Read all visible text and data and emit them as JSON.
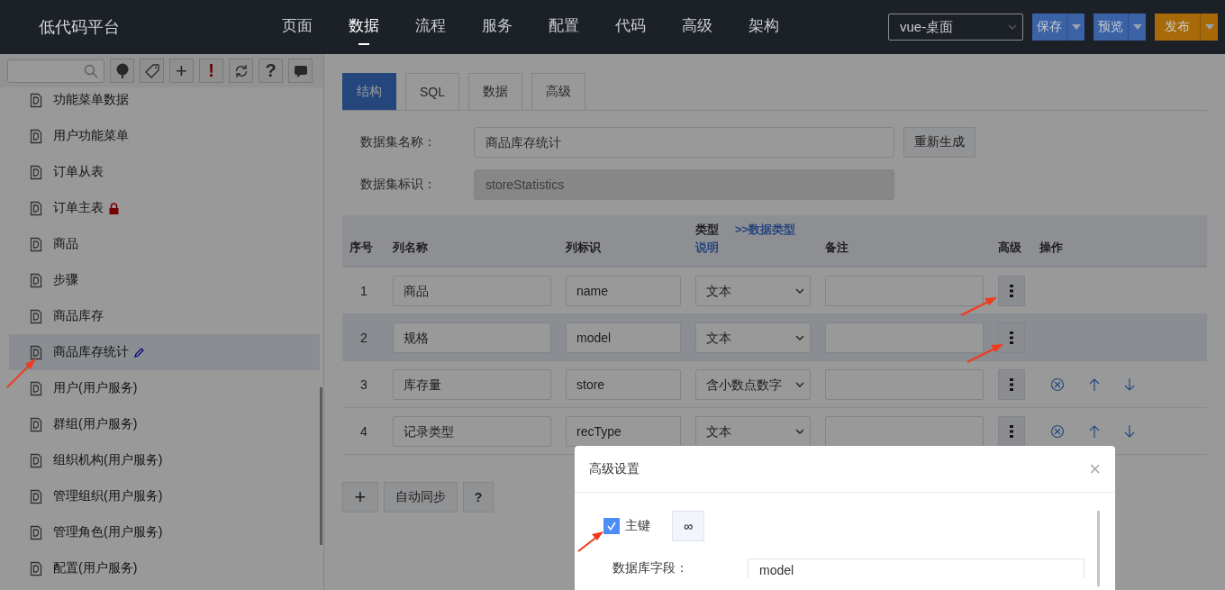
{
  "app_title": "低代码平台",
  "nav": [
    {
      "label": "页面",
      "selected": false
    },
    {
      "label": "数据",
      "selected": true
    },
    {
      "label": "流程",
      "selected": false
    },
    {
      "label": "服务",
      "selected": false
    },
    {
      "label": "配置",
      "selected": false
    },
    {
      "label": "代码",
      "selected": false
    },
    {
      "label": "高级",
      "selected": false
    },
    {
      "label": "架构",
      "selected": false
    }
  ],
  "target_select": {
    "value": "vue-桌面"
  },
  "actions": [
    {
      "label": "保存",
      "kind": "primary"
    },
    {
      "label": "预览",
      "kind": "primary"
    },
    {
      "label": "发布",
      "kind": "warning"
    }
  ],
  "sidebar_tools": [
    {
      "kind": "tree"
    },
    {
      "kind": "tag"
    },
    {
      "kind": "add",
      "text": "+"
    },
    {
      "kind": "alert",
      "text": "!"
    },
    {
      "kind": "refresh"
    },
    {
      "kind": "help",
      "text": "?"
    },
    {
      "kind": "chat"
    }
  ],
  "sidebar_items": [
    {
      "label": "功能菜单数据",
      "selected": false,
      "locked": false
    },
    {
      "label": "用户功能菜单",
      "selected": false,
      "locked": false
    },
    {
      "label": "订单从表",
      "selected": false,
      "locked": false
    },
    {
      "label": "订单主表",
      "selected": false,
      "locked": true
    },
    {
      "label": "商品",
      "selected": false,
      "locked": false
    },
    {
      "label": "步骤",
      "selected": false,
      "locked": false
    },
    {
      "label": "商品库存",
      "selected": false,
      "locked": false
    },
    {
      "label": "商品库存统计",
      "selected": true,
      "locked": false
    },
    {
      "label": "用户(用户服务)",
      "selected": false,
      "locked": false
    },
    {
      "label": "群组(用户服务)",
      "selected": false,
      "locked": false
    },
    {
      "label": "组织机构(用户服务)",
      "selected": false,
      "locked": false
    },
    {
      "label": "管理组织(用户服务)",
      "selected": false,
      "locked": false
    },
    {
      "label": "管理角色(用户服务)",
      "selected": false,
      "locked": false
    },
    {
      "label": "配置(用户服务)",
      "selected": false,
      "locked": false
    }
  ],
  "tabs": [
    {
      "label": "结构",
      "selected": true
    },
    {
      "label": "SQL",
      "selected": false
    },
    {
      "label": "数据",
      "selected": false
    },
    {
      "label": "高级",
      "selected": false
    }
  ],
  "form": {
    "name_label": "数据集名称：",
    "name_value": "商品库存统计",
    "regenerate": "重新生成",
    "id_label": "数据集标识：",
    "id_value": "storeStatistics",
    "id_disabled": true
  },
  "table": {
    "headers": {
      "index": "序号",
      "name": "列名称",
      "key": "列标识",
      "type": "类型",
      "type_hint": "说明",
      "type_link": ">>数据类型",
      "note": "备注",
      "advanced": "高级",
      "ops": "操作"
    },
    "rows": [
      {
        "index": "1",
        "name": "商品",
        "key": "name",
        "type": "文本",
        "selected": false,
        "actions": false
      },
      {
        "index": "2",
        "name": "规格",
        "key": "model",
        "type": "文本",
        "selected": true,
        "actions": false
      },
      {
        "index": "3",
        "name": "库存量",
        "key": "store",
        "type": "含小数点数字",
        "selected": false,
        "actions": true
      },
      {
        "index": "4",
        "name": "记录类型",
        "key": "recType",
        "type": "文本",
        "selected": false,
        "actions": true
      }
    ]
  },
  "bottom_buttons": {
    "add": "+",
    "sync": "自动同步",
    "help": "?"
  },
  "modal": {
    "title": "高级设置",
    "close": "×",
    "primary_key": {
      "label": "主键",
      "checked": true
    },
    "link_button": "∞",
    "field_label": "数据库字段：",
    "field_value": "model"
  }
}
